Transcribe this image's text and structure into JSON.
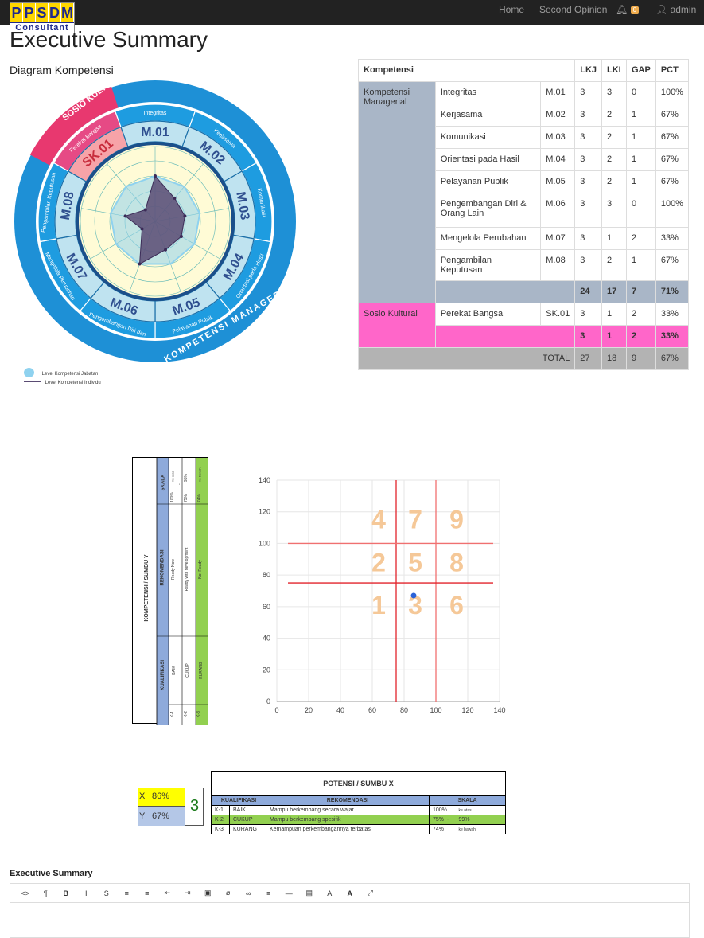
{
  "nav": {
    "logo_letters": [
      "P",
      "P",
      "S",
      "D",
      "M"
    ],
    "logo_sub": "Consultant",
    "home": "Home",
    "second_opinion": "Second Opinion",
    "notif_count": "0",
    "user": "admin",
    "bell_icon": "bell-icon",
    "user_icon": "user-icon"
  },
  "page_title": "Executive Summary",
  "diagram_title": "Diagram Kompetensi",
  "radar": {
    "outer_top": "SOSIO KULTURAL",
    "outer_bottom": "KOMPETENSI MANAGERIAL",
    "segments": [
      {
        "code": "M.01",
        "name": "Integritas"
      },
      {
        "code": "M.02",
        "name": "Kerjasama"
      },
      {
        "code": "M.03",
        "name": "Komunikasi"
      },
      {
        "code": "M.04",
        "name": "Orientasi pada Hasil"
      },
      {
        "code": "M.05",
        "name": "Pelayanan Publik"
      },
      {
        "code": "M.06",
        "name": "Pengembangan Diri dan Orang Lain"
      },
      {
        "code": "M.07",
        "name": "Mengelola Perubahan"
      },
      {
        "code": "M.08",
        "name": "Pengambilan Keputusan"
      },
      {
        "code": "SK.01",
        "name": "Perekat Bangsa"
      }
    ],
    "legend_jabatan": "Level Kompetensi Jabatan",
    "legend_individu": "Level Kompetensi Individu",
    "colors": {
      "blue": "#1e90d6",
      "light": "#bfe3f0",
      "cream": "#fffbd6",
      "pink": "#e8386f",
      "polygon": "#5a4b73"
    }
  },
  "table": {
    "headers": {
      "kompetensi": "Kompetensi",
      "lkj": "LKJ",
      "lki": "LKI",
      "gap": "GAP",
      "pct": "PCT"
    },
    "group1": "Kompetensi Managerial",
    "group2": "Sosio Kultural",
    "rows": [
      {
        "name": "Integritas",
        "code": "M.01",
        "lkj": "3",
        "lki": "3",
        "gap": "0",
        "pct": "100%"
      },
      {
        "name": "Kerjasama",
        "code": "M.02",
        "lkj": "3",
        "lki": "2",
        "gap": "1",
        "pct": "67%"
      },
      {
        "name": "Komunikasi",
        "code": "M.03",
        "lkj": "3",
        "lki": "2",
        "gap": "1",
        "pct": "67%"
      },
      {
        "name": "Orientasi pada Hasil",
        "code": "M.04",
        "lkj": "3",
        "lki": "2",
        "gap": "1",
        "pct": "67%"
      },
      {
        "name": "Pelayanan Publik",
        "code": "M.05",
        "lkj": "3",
        "lki": "2",
        "gap": "1",
        "pct": "67%"
      },
      {
        "name": "Pengembangan Diri & Orang Lain",
        "code": "M.06",
        "lkj": "3",
        "lki": "3",
        "gap": "0",
        "pct": "100%"
      },
      {
        "name": "Mengelola Perubahan",
        "code": "M.07",
        "lkj": "3",
        "lki": "1",
        "gap": "2",
        "pct": "33%"
      },
      {
        "name": "Pengambilan Keputusan",
        "code": "M.08",
        "lkj": "3",
        "lki": "2",
        "gap": "1",
        "pct": "67%"
      }
    ],
    "sub1": {
      "lkj": "24",
      "lki": "17",
      "gap": "7",
      "pct": "71%"
    },
    "sk_row": {
      "name": "Perekat Bangsa",
      "code": "SK.01",
      "lkj": "3",
      "lki": "1",
      "gap": "2",
      "pct": "33%"
    },
    "sub2": {
      "lkj": "3",
      "lki": "1",
      "gap": "2",
      "pct": "33%"
    },
    "total": {
      "label": "TOTAL",
      "lkj": "27",
      "lki": "18",
      "gap": "9",
      "pct": "67%"
    }
  },
  "ytable": {
    "title": "KOMPETENSI / SUMBU Y",
    "h_kual": "KUALIFIKASI",
    "h_rek": "REKOMENDASI",
    "h_skala": "SKALA",
    "rows": [
      {
        "k": "K-1",
        "kual": "BAIK",
        "rek": "Ready Now",
        "s1": "100%",
        "s2": "ke atas"
      },
      {
        "k": "K-2",
        "kual": "CUKUP",
        "rek": "Ready with development",
        "s1": "75%",
        "s2": "95%",
        "dash": "-"
      },
      {
        "k": "K-3",
        "kual": "KURANG",
        "rek": "Not Ready",
        "s1": "74%",
        "s2": "ke bawah"
      }
    ]
  },
  "xbox": {
    "x_label": "X",
    "x_val": "86%",
    "y_label": "Y",
    "y_val": "67%",
    "quadrant": "3"
  },
  "xtable": {
    "title": "POTENSI / SUMBU X",
    "h_kual": "KUALIFIKASI",
    "h_rek": "REKOMENDASI",
    "h_skala": "SKALA",
    "rows": [
      {
        "k": "K-1",
        "kual": "BAIK",
        "rek": "Mampu berkembang secara wajar",
        "s1": "100%",
        "s2": "ke atas"
      },
      {
        "k": "K-2",
        "kual": "CUKUP",
        "rek": "Mampu berkembang spesifik",
        "s1": "75%",
        "dash": "-",
        "s2": "99%"
      },
      {
        "k": "K-3",
        "kual": "KURANG",
        "rek": "Kemampuan perkembangannya terbatas",
        "s1": "74%",
        "s2": "ke bawah"
      }
    ]
  },
  "chart_data": {
    "type": "scatter",
    "x_ticks": [
      "0",
      "20",
      "40",
      "60",
      "80",
      "100",
      "120",
      "140"
    ],
    "y_ticks": [
      "0",
      "20",
      "40",
      "60",
      "80",
      "100",
      "120",
      "140"
    ],
    "xlim": [
      0,
      140
    ],
    "ylim": [
      0,
      140
    ],
    "points": [
      {
        "x": 86,
        "y": 67
      }
    ],
    "vlines": [
      {
        "x": 75,
        "y_from": 0,
        "y_to": 140
      },
      {
        "x": 100,
        "y_from": 0,
        "y_to": 140
      }
    ],
    "hlines": [
      {
        "y": 100,
        "x_from": 7,
        "x_to": 136
      },
      {
        "y": 75,
        "x_from": 7,
        "x_to": 136
      }
    ],
    "quadrant_labels": [
      {
        "text": "4",
        "x": 64,
        "y": 115
      },
      {
        "text": "7",
        "x": 87,
        "y": 115
      },
      {
        "text": "9",
        "x": 113,
        "y": 115
      },
      {
        "text": "2",
        "x": 64,
        "y": 88
      },
      {
        "text": "5",
        "x": 87,
        "y": 88
      },
      {
        "text": "8",
        "x": 113,
        "y": 88
      },
      {
        "text": "1",
        "x": 64,
        "y": 61
      },
      {
        "text": "3",
        "x": 87,
        "y": 61
      },
      {
        "text": "6",
        "x": 113,
        "y": 61
      }
    ],
    "grid": true
  },
  "editor": {
    "label": "Executive Summary",
    "tools": [
      "code-icon",
      "paragraph-icon",
      "bold-icon",
      "italic-icon",
      "strikethrough-icon",
      "bullet-list-icon",
      "numbered-list-icon",
      "outdent-icon",
      "indent-icon",
      "image-icon",
      "attach-icon",
      "link-icon",
      "align-icon",
      "hr-icon",
      "table-icon",
      "font-color-icon",
      "highlight-icon",
      "fullscreen-icon"
    ],
    "tool_glyphs": [
      "<>",
      "¶",
      "B",
      "I",
      "S",
      "≡",
      "≡",
      "⇤",
      "⇥",
      "▣",
      "⌀",
      "∞",
      "≡",
      "—",
      "▤",
      "A",
      "A",
      "⤢"
    ]
  }
}
